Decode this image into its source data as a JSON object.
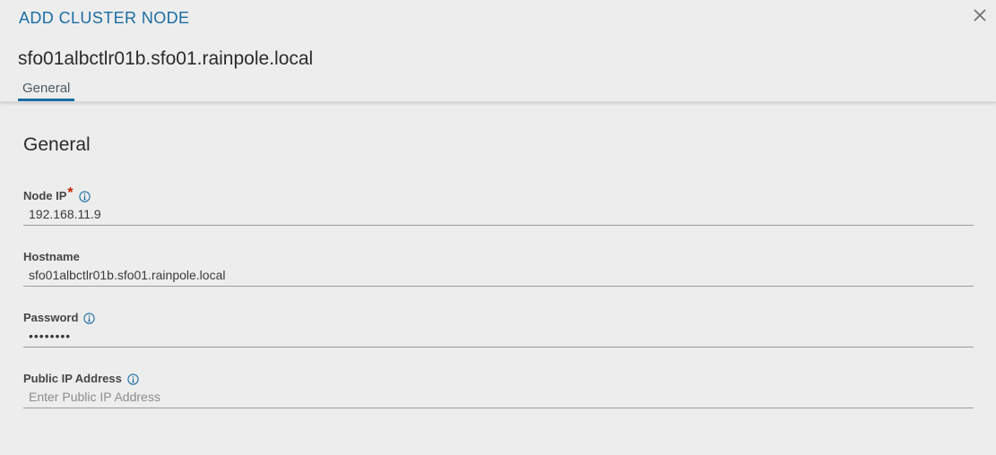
{
  "modal": {
    "title": "ADD CLUSTER NODE",
    "subtitle": "sfo01albctlr01b.sfo01.rainpole.local",
    "tabs": [
      {
        "label": "General",
        "active": true
      }
    ],
    "accent_color": "#1a6da3",
    "required_color": "#c92100"
  },
  "form": {
    "section_title": "General",
    "node_ip": {
      "label": "Node IP",
      "required_mark": "*",
      "value": "192.168.11.9",
      "icon": "info-icon"
    },
    "hostname": {
      "label": "Hostname",
      "value": "sfo01albctlr01b.sfo01.rainpole.local"
    },
    "password": {
      "label": "Password",
      "value": "••••••••",
      "icon": "info-icon"
    },
    "public_ip": {
      "label": "Public IP Address",
      "value": "",
      "placeholder": "Enter Public IP Address",
      "icon": "info-icon"
    }
  }
}
